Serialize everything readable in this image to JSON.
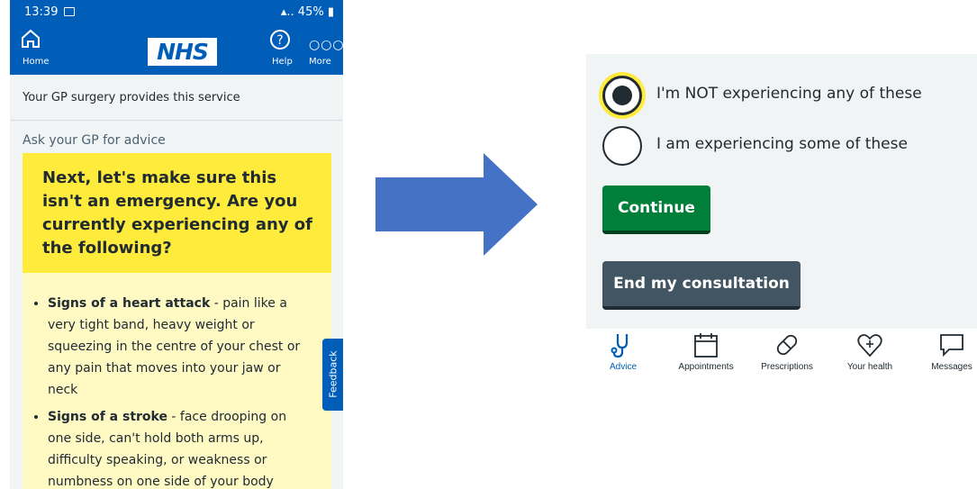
{
  "status_bar": {
    "time": "13:39",
    "battery": "45%"
  },
  "header": {
    "home_label": "Home",
    "logo": "NHS",
    "help_label": "Help",
    "more_label": "More"
  },
  "service_notice": "Your GP surgery provides this service",
  "section_label": "Ask your GP for advice",
  "emergency_heading": "Next, let's make sure this isn't an emergency. Are you currently experiencing any of the following?",
  "symptoms": [
    {
      "title": "Signs of a heart attack",
      "description": " - pain like a very tight band, heavy weight or squeezing in the centre of your chest or any pain that moves into your jaw or neck"
    },
    {
      "title": "Signs of a stroke",
      "description": " - face drooping on one side, can't hold both arms up, difficulty speaking, or weakness or numbness on one side of your body"
    }
  ],
  "feedback_label": "Feedback",
  "options": [
    {
      "label": "I'm NOT experiencing any of these",
      "selected": true
    },
    {
      "label": "I am experiencing some of these",
      "selected": false
    }
  ],
  "buttons": {
    "continue": "Continue",
    "end": "End my consultation"
  },
  "nav": {
    "advice": "Advice",
    "appointments": "Appointments",
    "prescriptions": "Prescriptions",
    "health": "Your health",
    "messages": "Messages"
  },
  "colors": {
    "nhs_blue": "#005eb8",
    "warning_yellow": "#ffeb3b",
    "continue_green": "#007f3b",
    "end_grey": "#425563",
    "arrow_blue": "#4472c4"
  },
  "icons": [
    "home-icon",
    "help-icon",
    "more-icon",
    "image-icon",
    "stethoscope-icon",
    "calendar-icon",
    "pill-icon",
    "heart-icon",
    "message-icon",
    "right-arrow-icon"
  ]
}
